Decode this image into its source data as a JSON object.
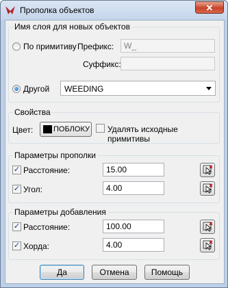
{
  "window": {
    "title": "Прополка объектов",
    "close_label": "✕"
  },
  "layer_group": {
    "title": "Имя слоя для новых объектов",
    "by_primitive_label": "По примитиву",
    "prefix_label": "Префикс:",
    "prefix_value": "W_",
    "suffix_label": "Суффикс:",
    "suffix_value": "",
    "other_label": "Другой",
    "other_value": "WEEDING",
    "selected": "other"
  },
  "properties_group": {
    "title": "Свойства",
    "color_label": "Цвет:",
    "color_value": "ПОБЛОКУ",
    "color_swatch": "#000000",
    "delete_label": "Удалять исходные примитивы",
    "delete_checked": false
  },
  "weeding_group": {
    "title": "Параметры прополки",
    "distance_label": "Расстояние:",
    "distance_value": "15.00",
    "distance_checked": true,
    "angle_label": "Угол:",
    "angle_value": "4.00",
    "angle_checked": true
  },
  "add_group": {
    "title": "Параметры добавления",
    "distance_label": "Расстояние:",
    "distance_value": "100.00",
    "distance_checked": true,
    "chord_label": "Хорда:",
    "chord_value": "4.00",
    "chord_checked": true
  },
  "buttons": {
    "ok": "Да",
    "cancel": "Отмена",
    "help": "Помощь"
  },
  "icons": {
    "app": "app-logo-icon",
    "pick": "pick-point-icon",
    "close": "close-icon"
  }
}
